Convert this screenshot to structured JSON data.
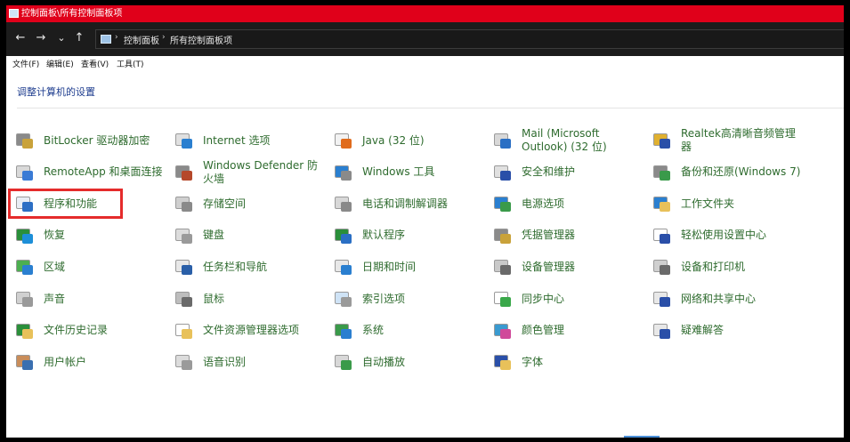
{
  "window": {
    "title": "控制面板\\所有控制面板项"
  },
  "nav": {
    "back": "←",
    "forward": "→",
    "recent": "⌄",
    "up": "↑",
    "breadcrumb": [
      "控制面板",
      "所有控制面板项"
    ],
    "sep": "›"
  },
  "menu": [
    "文件(F)",
    "编辑(E)",
    "查看(V)",
    "工具(T)"
  ],
  "heading": "调整计算机的设置",
  "columns": [
    [
      {
        "label": "BitLocker 驱动器加密",
        "icon": "bitlocker-icon",
        "c1": "#c9a23a",
        "c2": "#8a8a8a"
      },
      {
        "label": "RemoteApp 和桌面连接",
        "icon": "remoteapp-icon",
        "c1": "#3a7bd5",
        "c2": "#d9d9d9"
      },
      {
        "label": "程序和功能",
        "icon": "programs-features-icon",
        "c1": "#2d6fc4",
        "c2": "#e9eef5"
      },
      {
        "label": "恢复",
        "icon": "recovery-icon",
        "c1": "#1d8fd8",
        "c2": "#2a8f3a"
      },
      {
        "label": "区域",
        "icon": "region-icon",
        "c1": "#2a7fd0",
        "c2": "#4caf50"
      },
      {
        "label": "声音",
        "icon": "sound-icon",
        "c1": "#9a9a9a",
        "c2": "#d0d0d0"
      },
      {
        "label": "文件历史记录",
        "icon": "file-history-icon",
        "c1": "#e8c15a",
        "c2": "#2a8f3a"
      },
      {
        "label": "用户帐户",
        "icon": "user-accounts-icon",
        "c1": "#3a6fb0",
        "c2": "#c98d5a"
      }
    ],
    [
      {
        "label": "Internet 选项",
        "icon": "internet-options-icon",
        "c1": "#2a7fd0",
        "c2": "#e0e0e0"
      },
      {
        "label": "Windows Defender 防火墙",
        "icon": "firewall-icon",
        "c1": "#b5482a",
        "c2": "#8a8a8a"
      },
      {
        "label": "存储空间",
        "icon": "storage-spaces-icon",
        "c1": "#8a8a8a",
        "c2": "#cfcfcf"
      },
      {
        "label": "键盘",
        "icon": "keyboard-icon",
        "c1": "#9a9a9a",
        "c2": "#dcdcdc"
      },
      {
        "label": "任务栏和导航",
        "icon": "taskbar-icon",
        "c1": "#2a5fa8",
        "c2": "#e8e8e8"
      },
      {
        "label": "鼠标",
        "icon": "mouse-icon",
        "c1": "#6a6a6a",
        "c2": "#bdbdbd"
      },
      {
        "label": "文件资源管理器选项",
        "icon": "explorer-options-icon",
        "c1": "#e8c15a",
        "c2": "#ffffff"
      },
      {
        "label": "语音识别",
        "icon": "speech-recognition-icon",
        "c1": "#9a9a9a",
        "c2": "#dcdcdc"
      }
    ],
    [
      {
        "label": "Java (32 位)",
        "icon": "java-icon",
        "c1": "#e06b1c",
        "c2": "#f2f2f2"
      },
      {
        "label": "Windows 工具",
        "icon": "windows-tools-icon",
        "c1": "#8a8a8a",
        "c2": "#2a7fd0"
      },
      {
        "label": "电话和调制解调器",
        "icon": "phone-modem-icon",
        "c1": "#8a8a8a",
        "c2": "#d8d8d8"
      },
      {
        "label": "默认程序",
        "icon": "default-programs-icon",
        "c1": "#2a6fc4",
        "c2": "#2a8f3a"
      },
      {
        "label": "日期和时间",
        "icon": "date-time-icon",
        "c1": "#2a7fd0",
        "c2": "#e8e8e8"
      },
      {
        "label": "索引选项",
        "icon": "indexing-options-icon",
        "c1": "#9a9a9a",
        "c2": "#cfe3f6"
      },
      {
        "label": "系统",
        "icon": "system-icon",
        "c1": "#2a7fd0",
        "c2": "#3a9a4a"
      },
      {
        "label": "自动播放",
        "icon": "autoplay-icon",
        "c1": "#3a9a4a",
        "c2": "#d8d8d8"
      }
    ],
    [
      {
        "label": "Mail (Microsoft Outlook) (32 位)",
        "icon": "mail-icon",
        "c1": "#2a6fc4",
        "c2": "#d8d8d8"
      },
      {
        "label": "安全和维护",
        "icon": "security-maintenance-icon",
        "c1": "#2a4fa8",
        "c2": "#e0e0e0"
      },
      {
        "label": "电源选项",
        "icon": "power-options-icon",
        "c1": "#3a9a4a",
        "c2": "#2a7fd0"
      },
      {
        "label": "凭据管理器",
        "icon": "credential-manager-icon",
        "c1": "#c9a23a",
        "c2": "#8a8a8a"
      },
      {
        "label": "设备管理器",
        "icon": "device-manager-icon",
        "c1": "#6a6a6a",
        "c2": "#c9c9c9"
      },
      {
        "label": "同步中心",
        "icon": "sync-center-icon",
        "c1": "#3aa84a",
        "c2": "#ffffff"
      },
      {
        "label": "颜色管理",
        "icon": "color-management-icon",
        "c1": "#d04a9a",
        "c2": "#3a9ad0"
      },
      {
        "label": "字体",
        "icon": "fonts-icon",
        "c1": "#e8c15a",
        "c2": "#2a4fa8"
      }
    ],
    [
      {
        "label": "Realtek高清晰音频管理器",
        "icon": "realtek-audio-icon",
        "c1": "#2a4fa8",
        "c2": "#e0b030"
      },
      {
        "label": "备份和还原(Windows 7)",
        "icon": "backup-restore-icon",
        "c1": "#3a9a4a",
        "c2": "#8a8a8a"
      },
      {
        "label": "工作文件夹",
        "icon": "work-folders-icon",
        "c1": "#e8c15a",
        "c2": "#2a7fd0"
      },
      {
        "label": "轻松使用设置中心",
        "icon": "ease-of-access-icon",
        "c1": "#2a4fa8",
        "c2": "#ffffff"
      },
      {
        "label": "设备和打印机",
        "icon": "devices-printers-icon",
        "c1": "#6a6a6a",
        "c2": "#cfcfcf"
      },
      {
        "label": "网络和共享中心",
        "icon": "network-sharing-icon",
        "c1": "#2a4fa8",
        "c2": "#e8e8e8"
      },
      {
        "label": "疑难解答",
        "icon": "troubleshooting-icon",
        "c1": "#2a4fa8",
        "c2": "#e8e8e8"
      }
    ]
  ],
  "colors": {
    "title_bar": "#e0001a",
    "nav_bar": "#1c1c1c",
    "link": "#2e6b2e",
    "heading": "#1e3d8f",
    "highlight": "#e52b2b"
  }
}
